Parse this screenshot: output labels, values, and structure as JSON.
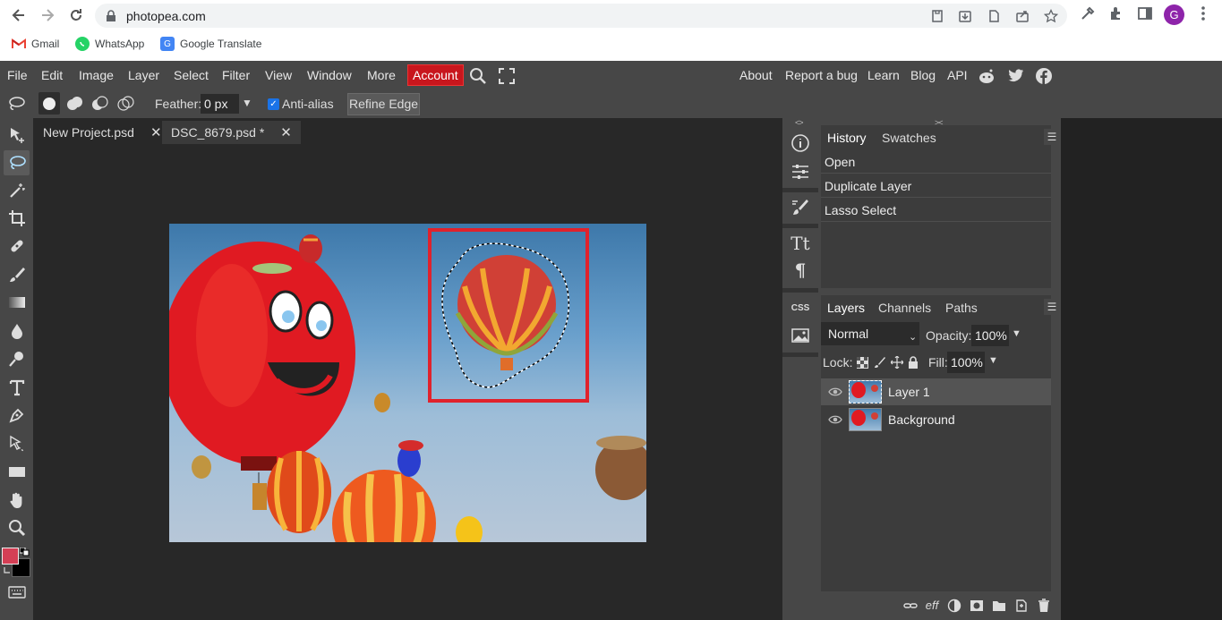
{
  "browser": {
    "url": "photopea.com",
    "profile_initial": "G",
    "bookmarks": [
      {
        "label": "Gmail"
      },
      {
        "label": "WhatsApp"
      },
      {
        "label": "Google Translate"
      }
    ]
  },
  "menu": {
    "items": [
      "File",
      "Edit",
      "Image",
      "Layer",
      "Select",
      "Filter",
      "View",
      "Window",
      "More"
    ],
    "account": "Account",
    "right_links": [
      "About",
      "Report a bug",
      "Learn",
      "Blog",
      "API"
    ]
  },
  "options": {
    "feather_label": "Feather:",
    "feather_value": "0 px",
    "antialias_label": "Anti-alias",
    "antialias_checked": true,
    "refine_edge": "Refine Edge"
  },
  "colors": {
    "foreground": "#d43f55",
    "background": "#000000",
    "account_red": "#c8161d",
    "highlight_rect": "#e0222c"
  },
  "tabs": [
    {
      "label": "New Project.psd",
      "active": false
    },
    {
      "label": "DSC_8679.psd *",
      "active": true
    }
  ],
  "history": {
    "tabs": [
      "History",
      "Swatches"
    ],
    "items": [
      "Open",
      "Duplicate Layer",
      "Lasso Select"
    ]
  },
  "layers_panel": {
    "tabs": [
      "Layers",
      "Channels",
      "Paths"
    ],
    "blend_mode": "Normal",
    "opacity_label": "Opacity:",
    "opacity": "100%",
    "lock_label": "Lock:",
    "fill_label": "Fill:",
    "fill": "100%",
    "layers": [
      {
        "name": "Layer 1",
        "active": true
      },
      {
        "name": "Background",
        "active": false
      }
    ]
  },
  "strip": {
    "css_label": "CSS",
    "text_label": "Tt",
    "para_label": "¶"
  }
}
